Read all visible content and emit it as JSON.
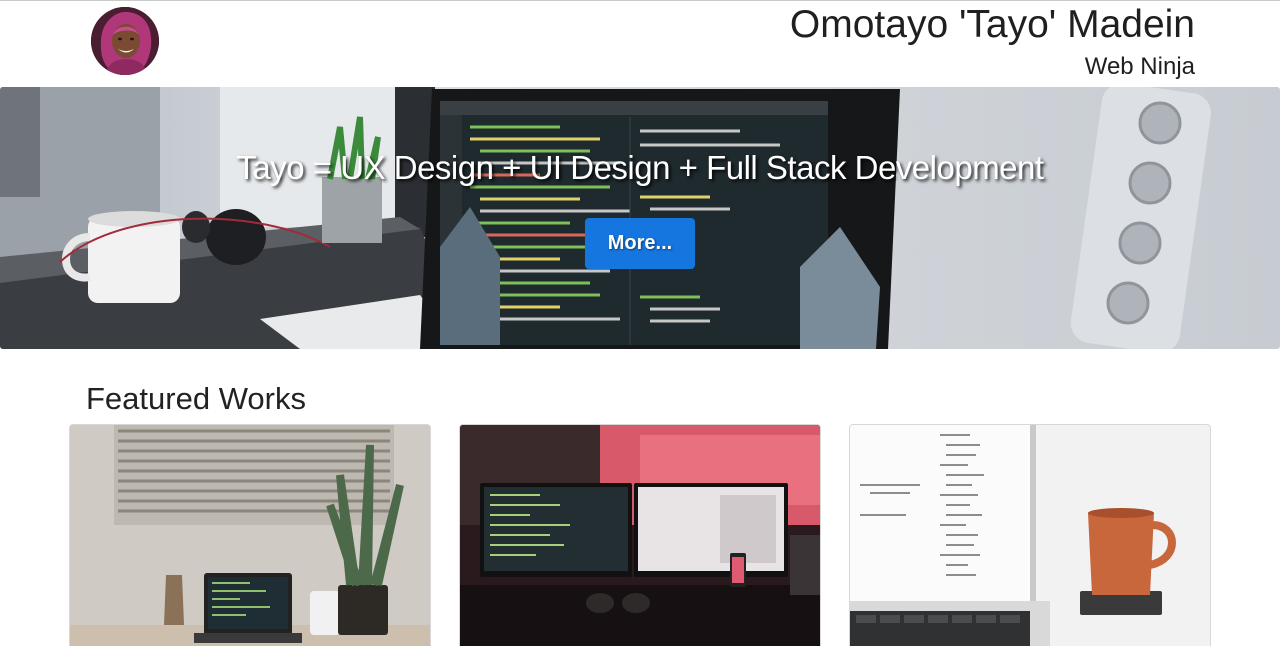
{
  "header": {
    "name": "Omotayo 'Tayo' Madein",
    "role": "Web Ninja",
    "avatar_icon": "profile-photo"
  },
  "hero": {
    "title": "Tayo = UX Design + UI Design + Full Stack Development",
    "button_label": "More...",
    "button_color": "#1676e0"
  },
  "featured": {
    "title": "Featured Works",
    "cards": [
      {
        "image": "desk-with-laptop-and-plant"
      },
      {
        "image": "dual-monitor-setup-red-room"
      },
      {
        "image": "laptop-with-orange-mug"
      }
    ]
  }
}
